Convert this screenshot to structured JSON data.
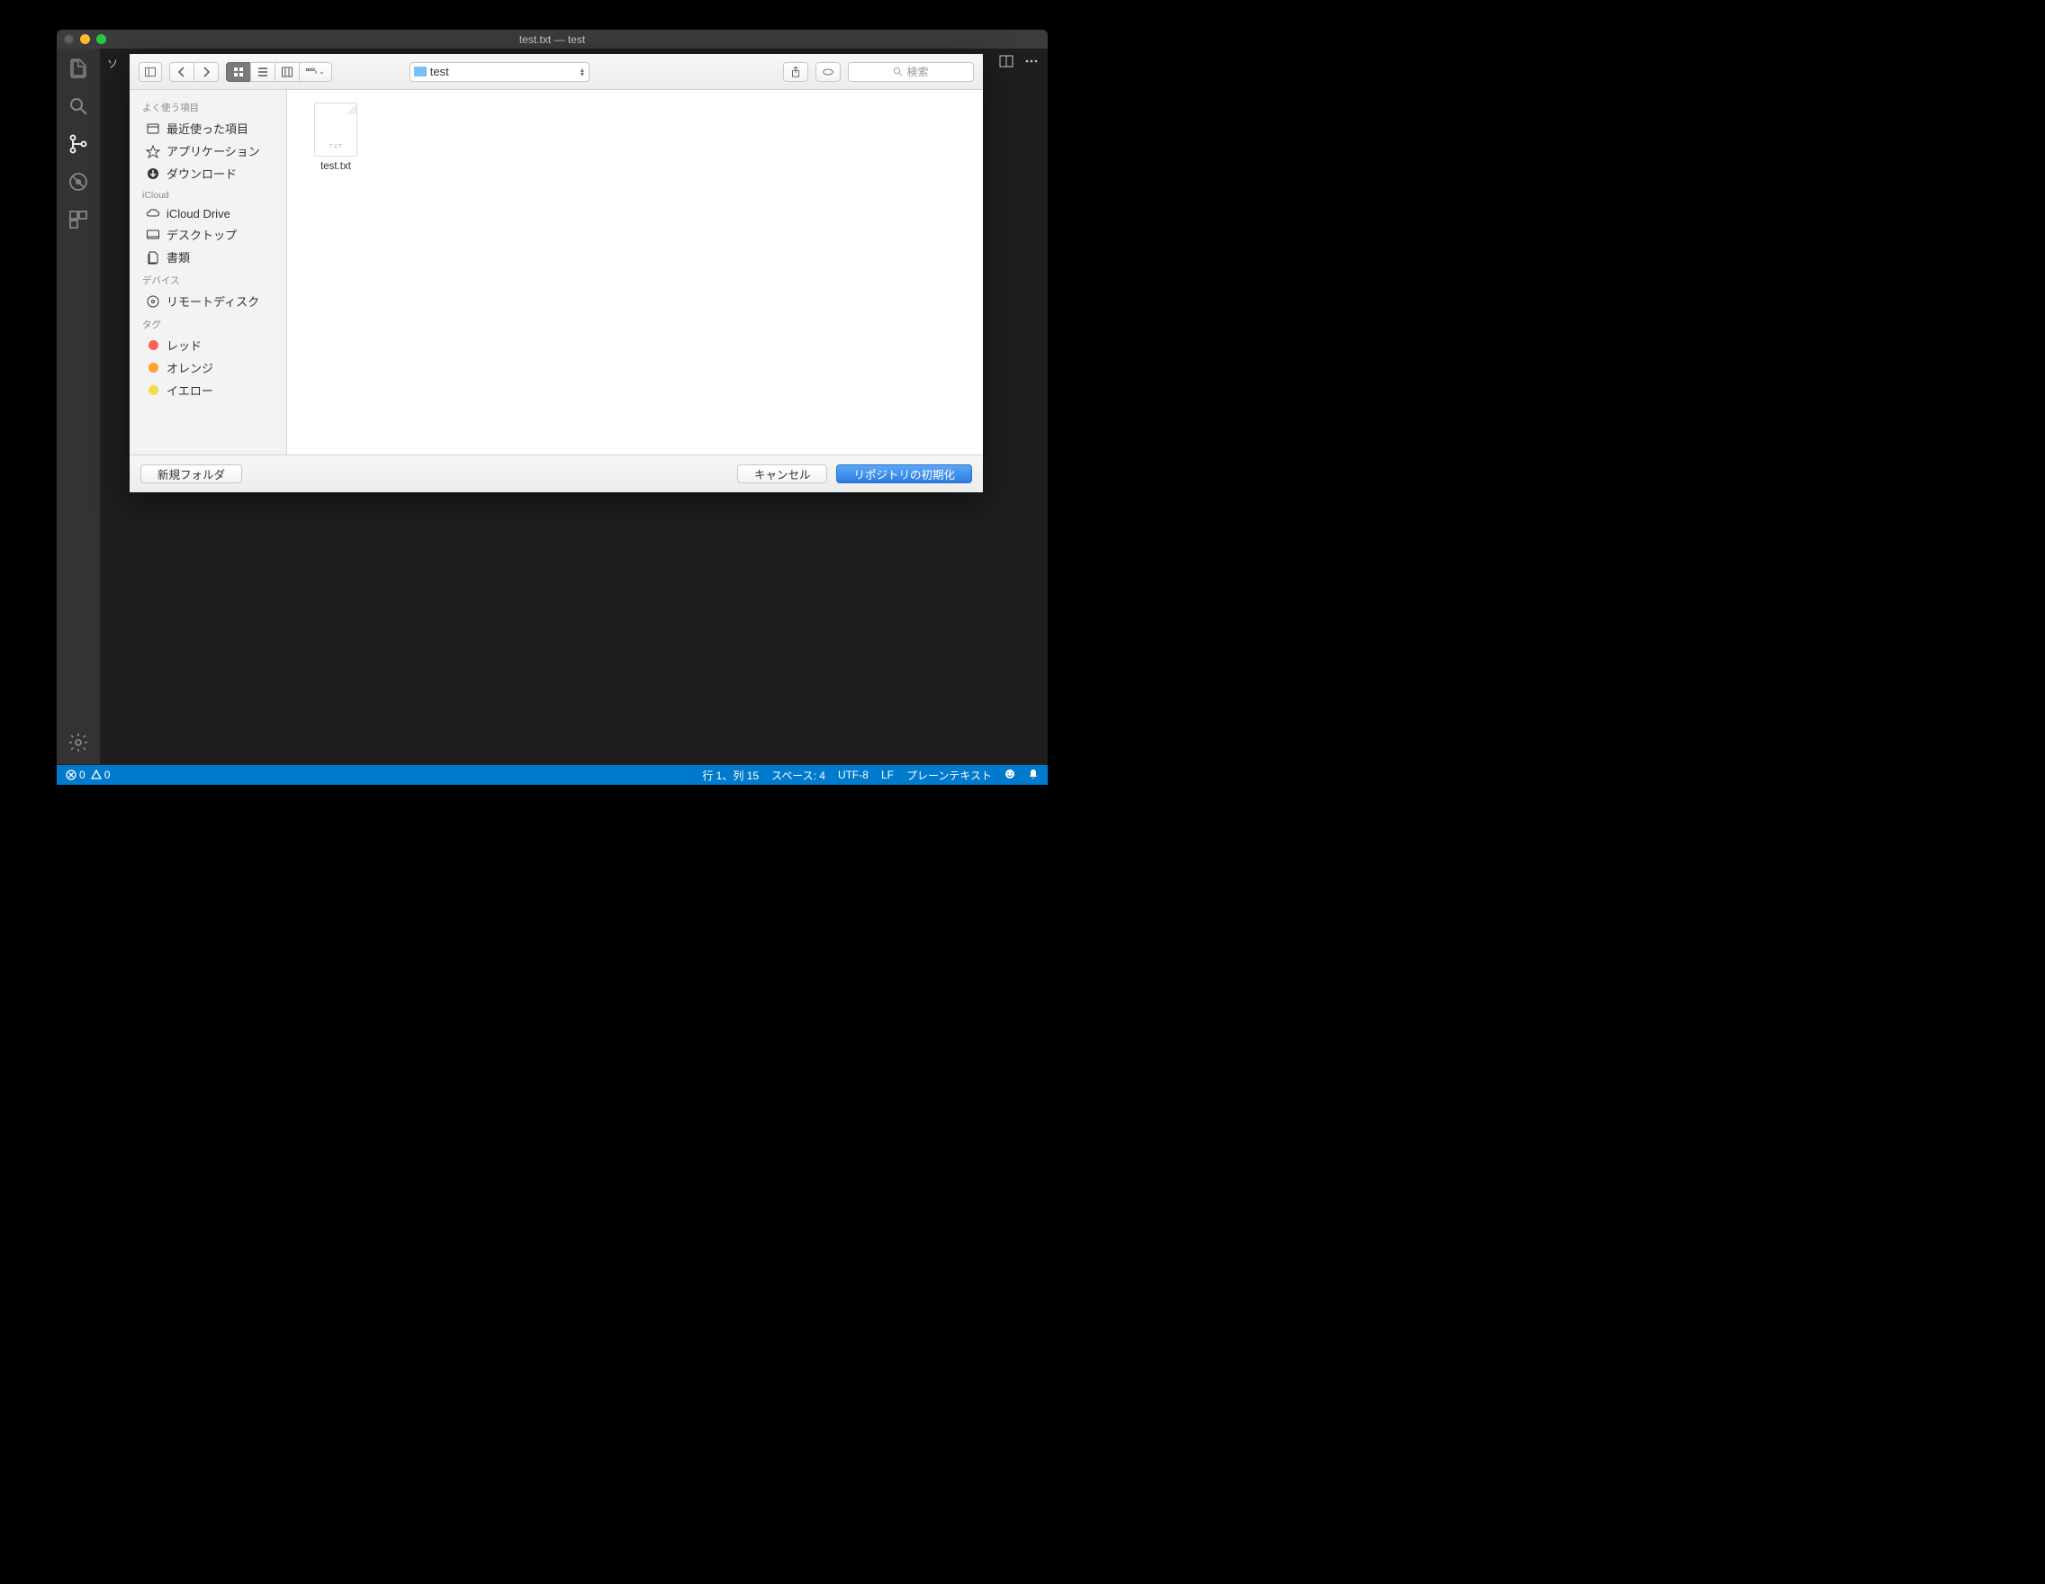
{
  "titlebar": {
    "title": "test.txt — test"
  },
  "side_hint": "ソ",
  "dialog": {
    "path_label": "test",
    "search_placeholder": "検索",
    "sidebar": {
      "favorites_header": "よく使う項目",
      "favorites": [
        {
          "label": "最近使った項目"
        },
        {
          "label": "アプリケーション"
        },
        {
          "label": "ダウンロード"
        }
      ],
      "icloud_header": "iCloud",
      "icloud": [
        {
          "label": "iCloud Drive"
        },
        {
          "label": "デスクトップ"
        },
        {
          "label": "書類"
        }
      ],
      "devices_header": "デバイス",
      "devices": [
        {
          "label": "リモートディスク"
        }
      ],
      "tags_header": "タグ",
      "tags": [
        {
          "label": "レッド",
          "color": "#ff5f57"
        },
        {
          "label": "オレンジ",
          "color": "#ffa030"
        },
        {
          "label": "イエロー",
          "color": "#f7d94c"
        }
      ]
    },
    "files": [
      {
        "name": "test.txt"
      }
    ],
    "new_folder": "新規フォルダ",
    "cancel": "キャンセル",
    "confirm": "リポジトリの初期化"
  },
  "status": {
    "errors": "0",
    "warnings": "0",
    "position": "行 1、列 15",
    "spaces": "スペース: 4",
    "encoding": "UTF-8",
    "eol": "LF",
    "language": "プレーンテキスト"
  }
}
